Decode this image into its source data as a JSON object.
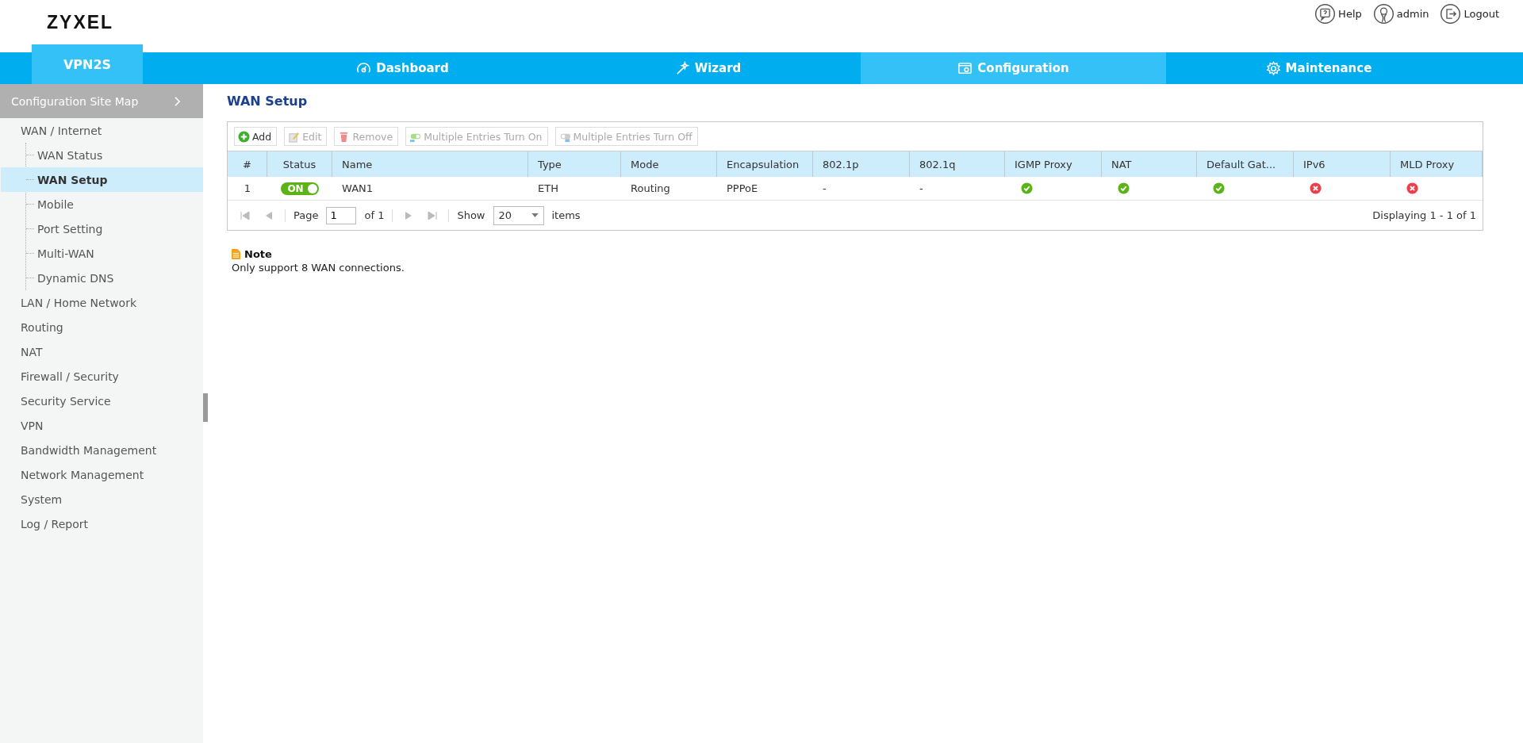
{
  "header": {
    "logo": "ZYXEL",
    "links": [
      {
        "kind": "help",
        "label": "Help"
      },
      {
        "kind": "user",
        "label": "admin"
      },
      {
        "kind": "logout",
        "label": "Logout"
      }
    ]
  },
  "nav": {
    "model": "VPN2S",
    "items": [
      {
        "kind": "dashboard",
        "label": "Dashboard",
        "selected": false
      },
      {
        "kind": "wizard",
        "label": "Wizard",
        "selected": false
      },
      {
        "kind": "configuration",
        "label": "Configuration",
        "selected": true
      },
      {
        "kind": "maintenance",
        "label": "Maintenance",
        "selected": false
      }
    ]
  },
  "sidebar": {
    "title": "Configuration Site Map",
    "items": [
      {
        "label": "WAN / Internet",
        "selected": false,
        "children": [
          {
            "label": "WAN Status",
            "selected": false
          },
          {
            "label": "WAN Setup",
            "selected": true
          },
          {
            "label": "Mobile",
            "selected": false
          },
          {
            "label": "Port Setting",
            "selected": false
          },
          {
            "label": "Multi-WAN",
            "selected": false
          },
          {
            "label": "Dynamic DNS",
            "selected": false
          }
        ]
      },
      {
        "label": "LAN / Home Network",
        "selected": false
      },
      {
        "label": "Routing",
        "selected": false
      },
      {
        "label": "NAT",
        "selected": false
      },
      {
        "label": "Firewall / Security",
        "selected": false
      },
      {
        "label": "Security Service",
        "selected": false
      },
      {
        "label": "VPN",
        "selected": false
      },
      {
        "label": "Bandwidth Management",
        "selected": false
      },
      {
        "label": "Network Management",
        "selected": false
      },
      {
        "label": "System",
        "selected": false
      },
      {
        "label": "Log / Report",
        "selected": false
      }
    ]
  },
  "page": {
    "title": "WAN Setup",
    "toolbar": [
      {
        "kind": "add",
        "label": "Add",
        "disabled": false
      },
      {
        "kind": "edit",
        "label": "Edit",
        "disabled": true
      },
      {
        "kind": "remove",
        "label": "Remove",
        "disabled": true
      },
      {
        "kind": "turn-on",
        "label": "Multiple Entries Turn On",
        "disabled": true
      },
      {
        "kind": "turn-off",
        "label": "Multiple Entries Turn Off",
        "disabled": true
      }
    ],
    "table": {
      "columns": [
        "#",
        "Status",
        "Name",
        "Type",
        "Mode",
        "Encapsulation",
        "802.1p",
        "802.1q",
        "IGMP Proxy",
        "NAT",
        "Default Gat...",
        "IPv6",
        "MLD Proxy"
      ],
      "rows": [
        {
          "cells": [
            {
              "kind": "text",
              "text": "1"
            },
            {
              "kind": "toggle",
              "label": "ON",
              "on": true
            },
            {
              "kind": "text",
              "text": "WAN1"
            },
            {
              "kind": "text",
              "text": "ETH"
            },
            {
              "kind": "text",
              "text": "Routing"
            },
            {
              "kind": "text",
              "text": "PPPoE"
            },
            {
              "kind": "text",
              "text": "-"
            },
            {
              "kind": "text",
              "text": "-"
            },
            {
              "kind": "status",
              "enabled": true
            },
            {
              "kind": "status",
              "enabled": true
            },
            {
              "kind": "status",
              "enabled": true
            },
            {
              "kind": "status",
              "enabled": false
            },
            {
              "kind": "status",
              "enabled": false
            }
          ]
        }
      ]
    },
    "pager": {
      "page_label": "Page",
      "page": "1",
      "of": "of 1",
      "show_label": "Show",
      "show": "20",
      "items_label": "items",
      "displaying": "Displaying 1 - 1 of 1"
    },
    "note": {
      "title": "Note",
      "text": "Only support 8 WAN connections."
    }
  }
}
